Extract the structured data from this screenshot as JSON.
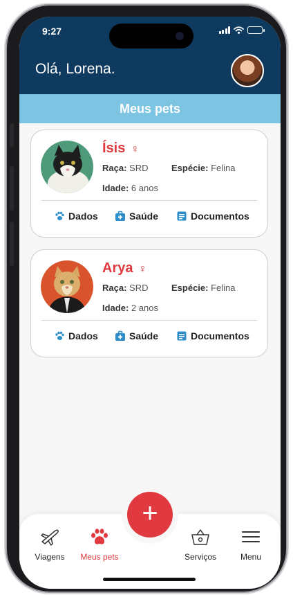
{
  "status": {
    "time": "9:27"
  },
  "header": {
    "greeting": "Olá, Lorena."
  },
  "section": {
    "title": "Meus pets"
  },
  "labels": {
    "raca": "Raça:",
    "especie": "Espécie:",
    "idade": "Idade:"
  },
  "pets": [
    {
      "name": "Ísis",
      "gender_symbol": "♀",
      "raca": "SRD",
      "especie": "Felina",
      "idade": "6 anos"
    },
    {
      "name": "Arya",
      "gender_symbol": "♀",
      "raca": "SRD",
      "especie": "Felina",
      "idade": "2 anos"
    }
  ],
  "actions": {
    "dados": "Dados",
    "saude": "Saúde",
    "documentos": "Documentos"
  },
  "tabbar": {
    "items": [
      {
        "label": "Viagens",
        "icon": "airplane-icon"
      },
      {
        "label": "Meus pets",
        "icon": "paw-icon",
        "active": true
      },
      {
        "label": "Serviços",
        "icon": "basket-icon"
      },
      {
        "label": "Menu",
        "icon": "hamburger-menu-icon"
      }
    ],
    "fab_label": "+"
  },
  "colors": {
    "header": "#0f3a5f",
    "section_bar": "#7cc4e2",
    "accent": "#e0393f",
    "icon_blue": "#2e8ec9"
  }
}
